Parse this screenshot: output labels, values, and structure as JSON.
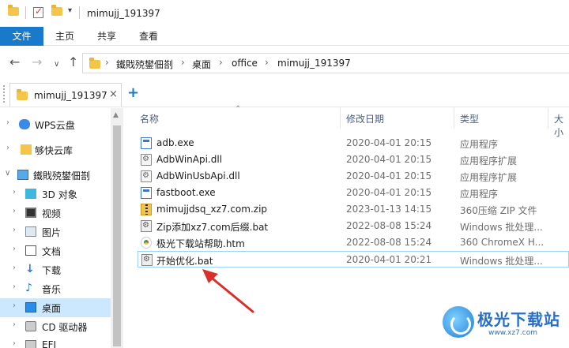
{
  "window": {
    "title": "mimujj_191397"
  },
  "ribbon": {
    "file": "文件",
    "home": "主页",
    "share": "共享",
    "view": "查看"
  },
  "address": {
    "crumbs": [
      "鐵戝殑鐢佃剳",
      "桌面",
      "office",
      "mimujj_191397"
    ]
  },
  "folder_tab": {
    "label": "mimujj_191397",
    "close": "×",
    "add": "+"
  },
  "sidebar": {
    "items": [
      {
        "label": "WPS云盘"
      },
      {
        "label": "够快云库"
      },
      {
        "label": "鐵戝殑鐢佃剳"
      },
      {
        "label": "3D 对象"
      },
      {
        "label": "视频"
      },
      {
        "label": "图片"
      },
      {
        "label": "文档"
      },
      {
        "label": "下载"
      },
      {
        "label": "音乐"
      },
      {
        "label": "桌面"
      },
      {
        "label": "CD 驱动器"
      },
      {
        "label": "EFI"
      }
    ]
  },
  "columns": {
    "name": "名称",
    "modified": "修改日期",
    "type": "类型",
    "size": "大小"
  },
  "files": [
    {
      "name": "adb.exe",
      "date": "2020-04-01 20:15",
      "type": "应用程序",
      "icon": "exe-icon"
    },
    {
      "name": "AdbWinApi.dll",
      "date": "2020-04-01 20:15",
      "type": "应用程序扩展",
      "icon": "dll-icon"
    },
    {
      "name": "AdbWinUsbApi.dll",
      "date": "2020-04-01 20:15",
      "type": "应用程序扩展",
      "icon": "dll-icon"
    },
    {
      "name": "fastboot.exe",
      "date": "2020-04-01 20:15",
      "type": "应用程序",
      "icon": "exe-icon"
    },
    {
      "name": "mimujjdsq_xz7.com.zip",
      "date": "2023-01-13 14:15",
      "type": "360压缩 ZIP 文件",
      "icon": "zip-icon"
    },
    {
      "name": "Zip添加xz7.com后缀.bat",
      "date": "2022-08-08 15:24",
      "type": "Windows 批处理...",
      "icon": "bat-icon"
    },
    {
      "name": "极光下载站帮助.htm",
      "date": "2022-08-08 15:24",
      "type": "360 ChromeX H...",
      "icon": "htm-icon"
    },
    {
      "name": "开始优化.bat",
      "date": "2020-04-01 20:21",
      "type": "Windows 批处理...",
      "icon": "bat-icon"
    }
  ],
  "watermark": {
    "text": "极光下载站",
    "url": "www.xz7.com"
  },
  "colors": {
    "accent": "#1979ca",
    "selection": "#cce8ff",
    "arrow": "#d9302a"
  }
}
